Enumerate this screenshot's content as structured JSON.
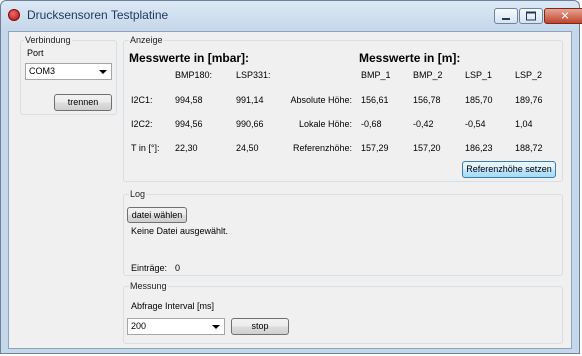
{
  "window": {
    "title": "Drucksensoren Testplatine"
  },
  "verbindung": {
    "group_label": "Verbindung",
    "port_label": "Port",
    "port_value": "COM3",
    "disconnect_label": "trennen"
  },
  "anzeige": {
    "group_label": "Anzeige",
    "mbar_header": "Messwerte in [mbar]:",
    "m_header": "Messwerte in [m]:",
    "mbar_columns": [
      "BMP180:",
      "LSP331:"
    ],
    "m_columns": [
      "BMP_1",
      "BMP_2",
      "LSP_1",
      "LSP_2"
    ],
    "rows": [
      {
        "label": "I2C1:",
        "bmp180": "994,58",
        "lsp331": "991,14"
      },
      {
        "label": "I2C2:",
        "bmp180": "994,56",
        "lsp331": "990,66"
      },
      {
        "label": "T in [°]:",
        "bmp180": "22,30",
        "lsp331": "24,50"
      }
    ],
    "m_rows": [
      {
        "label": "Absolute Höhe:",
        "values": [
          "156,61",
          "156,78",
          "185,70",
          "189,76"
        ]
      },
      {
        "label": "Lokale Höhe:",
        "values": [
          "-0,68",
          "-0,42",
          "-0,54",
          "1,04"
        ]
      },
      {
        "label": "Referenzhöhe:",
        "values": [
          "157,29",
          "157,20",
          "186,23",
          "188,72"
        ]
      }
    ],
    "set_reference_label": "Referenzhöhe setzen"
  },
  "log": {
    "group_label": "Log",
    "choose_file_label": "datei wählen",
    "no_file_text": "Keine Datei ausgewählt.",
    "entries_label": "Einträge:",
    "entries_count": "0"
  },
  "messung": {
    "group_label": "Messung",
    "interval_label": "Abfrage Interval [ms]",
    "interval_value": "200",
    "stop_label": "stop"
  }
}
